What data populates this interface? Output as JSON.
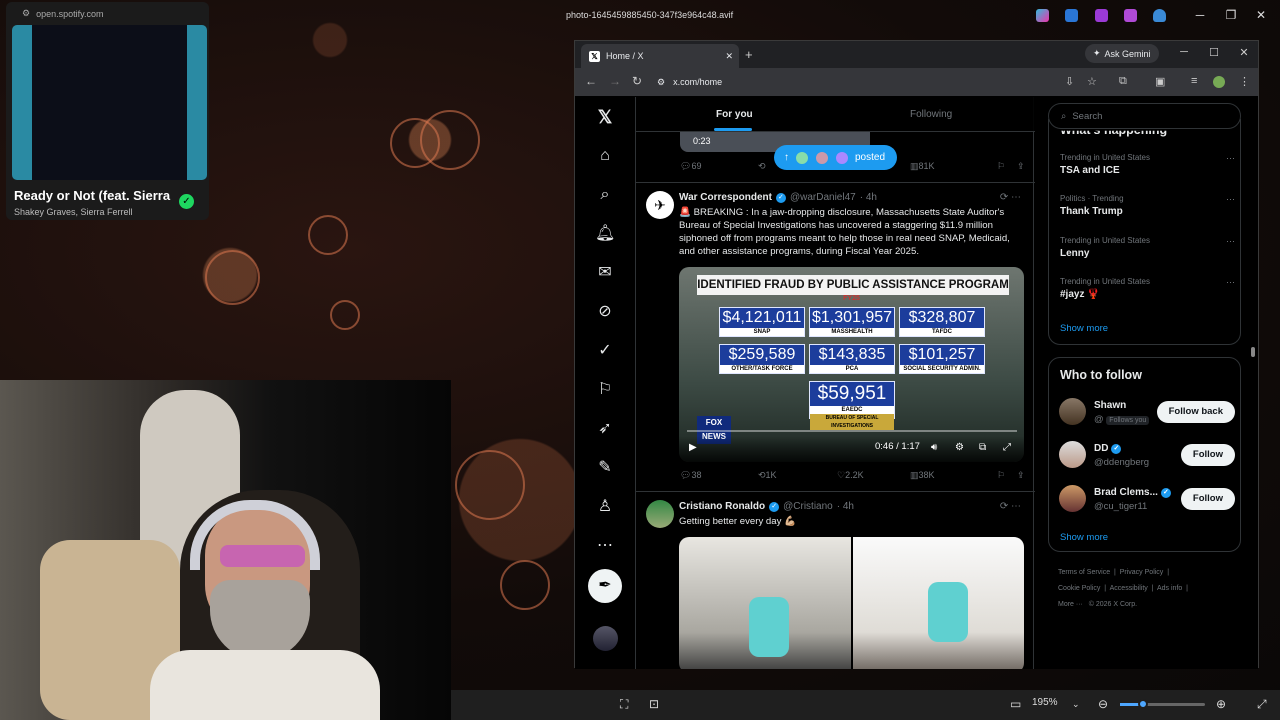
{
  "viewer": {
    "title": "photo-1645459885450-347f3e964c48.avif",
    "zoom": "195%"
  },
  "spotify": {
    "url": "open.spotify.com",
    "track": "Ready or Not (feat. Sierra",
    "artist": "Shakey Graves, Sierra Ferrell"
  },
  "browser": {
    "tab_title": "Home / X",
    "gemini_label": "Ask Gemini",
    "url": "x.com/home"
  },
  "timeline": {
    "tabs": [
      "For you",
      "Following"
    ],
    "prev_video_time": "0:23",
    "posted_label": "posted",
    "prev_actions": {
      "replies": "69",
      "views": "81K"
    },
    "tweet1": {
      "name": "War Correspondent",
      "handle": "@warDaniel47",
      "time": "· 4h",
      "text": "🚨 BREAKING : In a jaw-dropping disclosure, Massachusetts State Auditor's Bureau of Special Investigations has uncovered a staggering $11.9 million siphoned off from programs meant to help those in real need SNAP, Medicaid, and other assistance programs, during Fiscal Year 2025.",
      "video": {
        "headline": "IDENTIFIED FRAUD BY PUBLIC ASSISTANCE PROGRAM",
        "subhead": "FY25",
        "figures": [
          {
            "value": "$4,121,011",
            "label": "SNAP"
          },
          {
            "value": "$1,301,957",
            "label": "MASSHEALTH"
          },
          {
            "value": "$328,807",
            "label": "TAFDC"
          },
          {
            "value": "$259,589",
            "label": "OTHER/TASK FORCE"
          },
          {
            "value": "$143,835",
            "label": "PCA"
          },
          {
            "value": "$101,257",
            "label": "SOCIAL SECURITY ADMIN."
          },
          {
            "value": "$59,951",
            "label": "EAEDC"
          }
        ],
        "bureau": "BUREAU OF SPECIAL INVESTIGATIONS",
        "time": "0:46 / 1:17",
        "network": "FOX NEWS"
      },
      "actions": {
        "replies": "38",
        "reposts": "1K",
        "likes": "2.2K",
        "views": "38K"
      }
    },
    "tweet2": {
      "name": "Cristiano Ronaldo",
      "handle": "@Cristiano",
      "time": "· 4h",
      "text": "Getting better every day 💪🏼"
    }
  },
  "sidebar": {
    "search_placeholder": "Search",
    "happening_title": "What's happening",
    "trends": [
      {
        "context": "Trending in United States",
        "name": "TSA and ICE"
      },
      {
        "context": "Politics · Trending",
        "name": "Thank Trump"
      },
      {
        "context": "Trending in United States",
        "name": "Lenny"
      },
      {
        "context": "Trending in United States",
        "name": "#jayz 🦞"
      }
    ],
    "show_more": "Show more",
    "who_title": "Who to follow",
    "follow": [
      {
        "name": "Shawn",
        "handle": "@",
        "badge": "Follows you",
        "button": "Follow back"
      },
      {
        "name": "DD",
        "handle": "@ddengberg",
        "button": "Follow"
      },
      {
        "name": "Brad Clems...",
        "handle": "@cu_tiger11",
        "button": "Follow"
      }
    ],
    "footer": [
      "Terms of Service",
      "Privacy Policy",
      "Cookie Policy",
      "Accessibility",
      "Ads info",
      "More ···",
      "© 2026 X Corp."
    ]
  }
}
